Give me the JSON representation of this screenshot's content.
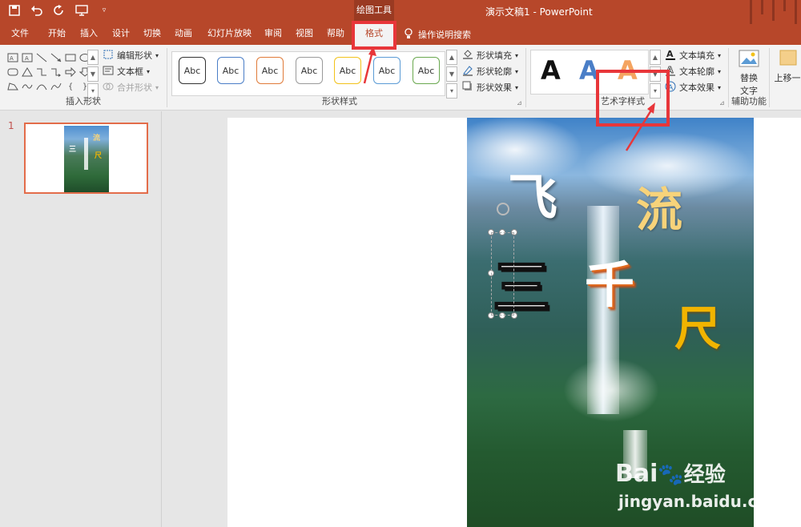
{
  "titlebar": {
    "context_tab_group": "绘图工具",
    "document_title": "演示文稿1  -  PowerPoint"
  },
  "tabs": [
    "文件",
    "开始",
    "插入",
    "设计",
    "切换",
    "动画",
    "幻灯片放映",
    "审阅",
    "视图",
    "帮助",
    "格式"
  ],
  "tell_me": "操作说明搜索",
  "ribbon": {
    "insert_shapes": {
      "label": "插入形状",
      "edit_shape": "编辑形状",
      "text_box": "文本框",
      "merge_shapes": "合并形状"
    },
    "shape_styles": {
      "label": "形状样式",
      "preset_text": "Abc",
      "presets": [
        "#333333",
        "#4a7ec7",
        "#e07b39",
        "#9a9a9a",
        "#f2c21b",
        "#5b9bd5",
        "#6aa84f"
      ],
      "fill": "形状填充",
      "outline": "形状轮廓",
      "effects": "形状效果"
    },
    "wordart_styles": {
      "label": "艺术字样式",
      "preset_letter": "A",
      "text_fill": "文本填充",
      "text_outline": "文本轮廓",
      "text_effects": "文本效果"
    },
    "accessibility": {
      "label": "辅助功能",
      "alt_text_line1": "替换",
      "alt_text_line2": "文字"
    },
    "arrange": {
      "bring_forward": "上移一"
    }
  },
  "slides_pane": {
    "slide_number": "1"
  },
  "slide": {
    "chars": [
      "飞",
      "流",
      "三",
      "千",
      "尺"
    ]
  },
  "watermark": {
    "brand": "Bai",
    "brand_tail": "经验",
    "url": "jingyan.baidu.com"
  }
}
